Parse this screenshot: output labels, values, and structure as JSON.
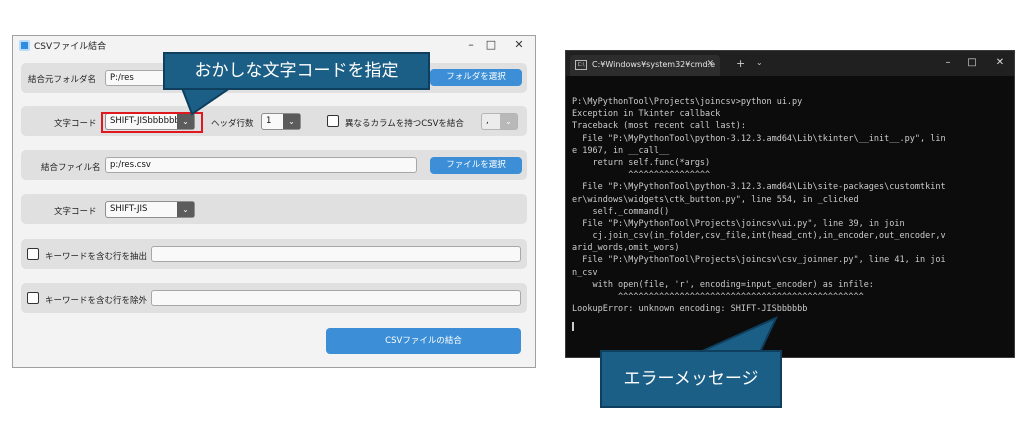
{
  "app": {
    "title": "CSVファイル結合",
    "rows": {
      "folder_label": "結合元フォルダ名",
      "folder_value": "P:/res",
      "folder_button": "フォルダを選択",
      "in_encoding_label": "文字コード",
      "in_encoding_value": "SHIFT-JISbbbbbb",
      "header_label": "ヘッダ行数",
      "header_value": "1",
      "diff_columns_label": "異なるカラムを持つCSVを結合",
      "diff_columns_value": ",",
      "output_label": "結合ファイル名",
      "output_value": "p:/res.csv",
      "output_button": "ファイルを選択",
      "out_encoding_label": "文字コード",
      "out_encoding_value": "SHIFT-JIS",
      "keyword_extract_label": "キーワードを含む行を抽出",
      "keyword_extract_value": "",
      "keyword_exclude_label": "キーワードを含む行を除外",
      "keyword_exclude_value": "",
      "merge_button": "CSVファイルの結合"
    }
  },
  "callouts": {
    "wrong_encoding": "おかしな文字コードを指定",
    "error_message": "エラーメッセージ"
  },
  "terminal": {
    "tab_title": "C:¥Windows¥system32¥cmd.e",
    "lines": [
      "P:\\MyPythonTool\\Projects\\joincsv>python ui.py",
      "Exception in Tkinter callback",
      "Traceback (most recent call last):",
      "  File \"P:\\MyPythonTool\\python-3.12.3.amd64\\Lib\\tkinter\\__init__.py\", lin",
      "e 1967, in __call__",
      "    return self.func(*args)",
      "           ^^^^^^^^^^^^^^^^",
      "  File \"P:\\MyPythonTool\\python-3.12.3.amd64\\Lib\\site-packages\\customtkint",
      "er\\windows\\widgets\\ctk_button.py\", line 554, in _clicked",
      "    self._command()",
      "  File \"P:\\MyPythonTool\\Projects\\joincsv\\ui.py\", line 39, in join",
      "    cj.join_csv(in_folder,csv_file,int(head_cnt),in_encoder,out_encoder,v",
      "arid_words,omit_wors)",
      "  File \"P:\\MyPythonTool\\Projects\\joincsv\\csv_joinner.py\", line 41, in joi",
      "n_csv",
      "    with open(file, 'r', encoding=input_encoder) as infile:",
      "         ^^^^^^^^^^^^^^^^^^^^^^^^^^^^^^^^^^^^^^^^^^^^^^^^",
      "LookupError: unknown encoding: SHIFT-JISbbbbbb"
    ]
  },
  "colors": {
    "accent_button": "#3c8fd6",
    "highlight_border": "#e01820",
    "callout_fill": "#1c5f86",
    "terminal_bg": "#0c0c0c"
  }
}
